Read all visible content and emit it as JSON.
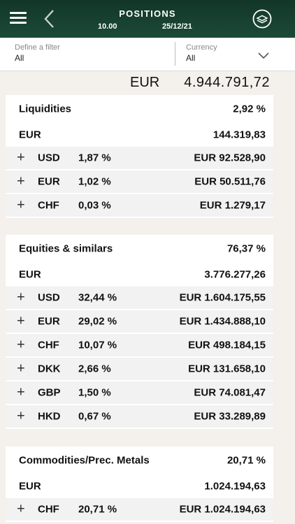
{
  "header": {
    "title": "POSITIONS",
    "time": "10.00",
    "date": "25/12/21"
  },
  "filter": {
    "label": "Define a filter",
    "value": "All"
  },
  "currency": {
    "label": "Currency",
    "value": "All"
  },
  "total": {
    "currency": "EUR",
    "value": "4.944.791,72"
  },
  "sections": [
    {
      "title": "Liquidities",
      "pct": "2,92 %",
      "sub_currency": "EUR",
      "sub_value": "144.319,83",
      "lines": [
        {
          "ccy": "USD",
          "pct": "1,87 %",
          "value": "EUR 92.528,90"
        },
        {
          "ccy": "EUR",
          "pct": "1,02 %",
          "value": "EUR 50.511,76"
        },
        {
          "ccy": "CHF",
          "pct": "0,03 %",
          "value": "EUR 1.279,17"
        }
      ]
    },
    {
      "title": "Equities & similars",
      "pct": "76,37 %",
      "sub_currency": "EUR",
      "sub_value": "3.776.277,26",
      "lines": [
        {
          "ccy": "USD",
          "pct": "32,44 %",
          "value": "EUR 1.604.175,55"
        },
        {
          "ccy": "EUR",
          "pct": "29,02 %",
          "value": "EUR 1.434.888,10"
        },
        {
          "ccy": "CHF",
          "pct": "10,07 %",
          "value": "EUR 498.184,15"
        },
        {
          "ccy": "DKK",
          "pct": "2,66 %",
          "value": "EUR 131.658,10"
        },
        {
          "ccy": "GBP",
          "pct": "1,50 %",
          "value": "EUR 74.081,47"
        },
        {
          "ccy": "HKD",
          "pct": "0,67 %",
          "value": "EUR 33.289,89"
        }
      ]
    },
    {
      "title": "Commodities/Prec. Metals",
      "pct": "20,71 %",
      "sub_currency": "EUR",
      "sub_value": "1.024.194,63",
      "lines": [
        {
          "ccy": "CHF",
          "pct": "20,71 %",
          "value": "EUR 1.024.194,63"
        }
      ]
    }
  ],
  "icons": {
    "menu": "hamburger-menu-icon",
    "back": "chevron-left-icon",
    "settings": "layers-circle-icon",
    "dropdown": "chevron-down-icon",
    "expand": "plus-icon"
  },
  "colors": {
    "header": "#1c4a37",
    "background": "#f4f0ec",
    "row_alt": "#f2f2f2"
  }
}
